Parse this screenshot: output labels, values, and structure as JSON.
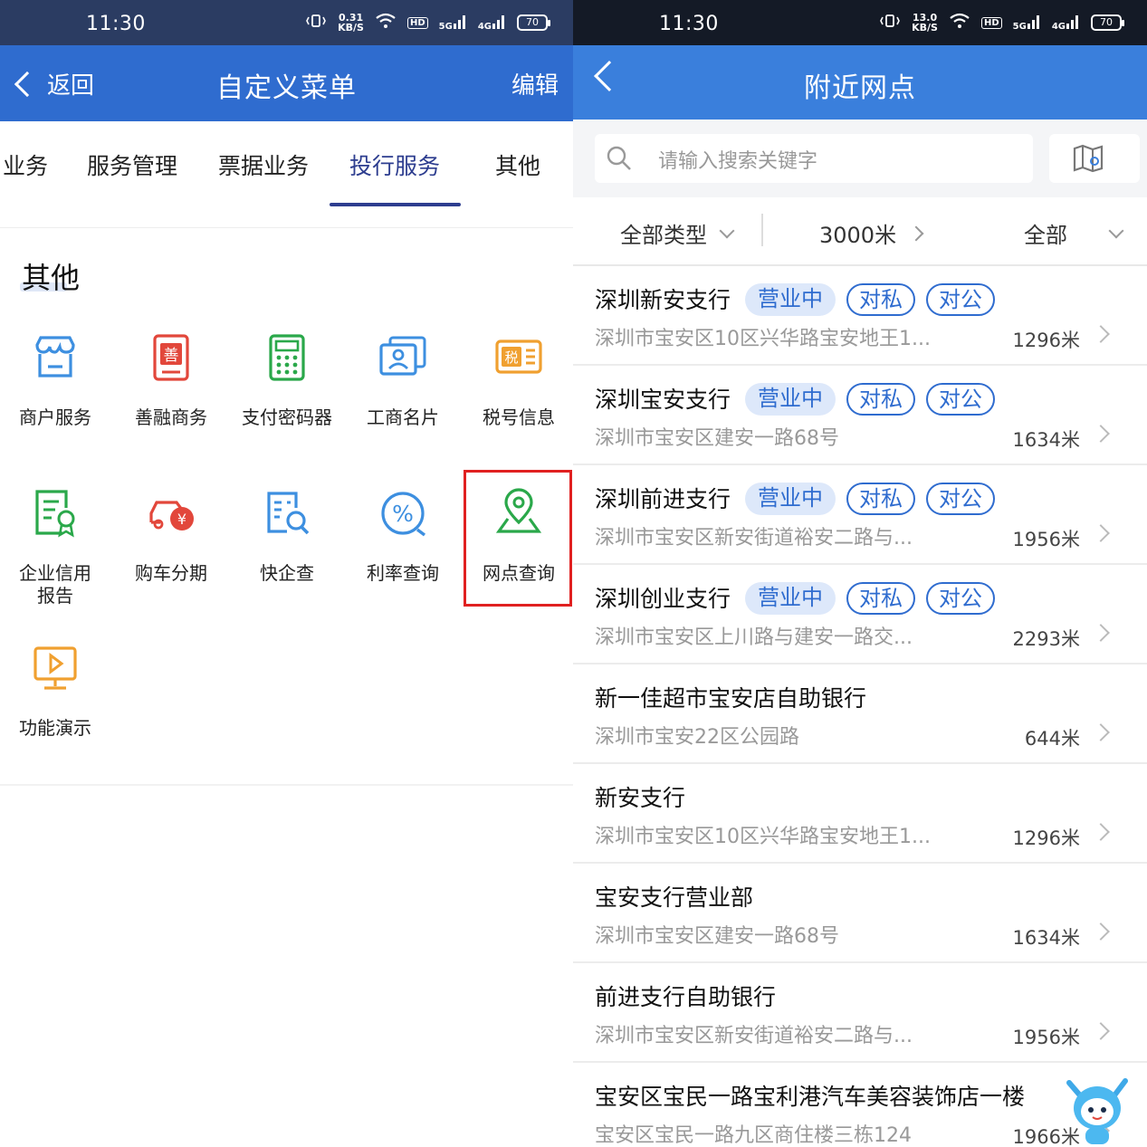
{
  "left": {
    "status": {
      "time": "11:30",
      "speed_value": "0.31",
      "speed_unit": "KB/S",
      "hd": "HD",
      "net5g": "5G",
      "net4g": "4G",
      "battery": "70"
    },
    "header": {
      "back_label": "返回",
      "title": "自定义菜单",
      "edit_label": "编辑"
    },
    "tabs": [
      "业务",
      "服务管理",
      "票据业务",
      "投行服务",
      "其他"
    ],
    "active_tab": "投行服务",
    "section_title": "其他",
    "items": [
      {
        "label": "商户服务",
        "icon": "shop-icon"
      },
      {
        "label": "善融商务",
        "icon": "shanrong-icon",
        "glyph": "善"
      },
      {
        "label": "支付密码器",
        "icon": "calculator-icon"
      },
      {
        "label": "工商名片",
        "icon": "business-card-icon"
      },
      {
        "label": "税号信息",
        "icon": "tax-icon",
        "glyph": "税"
      },
      {
        "label": "企业信用\n报告",
        "icon": "credit-report-icon"
      },
      {
        "label": "购车分期",
        "icon": "car-loan-icon",
        "glyph": "¥"
      },
      {
        "label": "快企查",
        "icon": "company-search-icon"
      },
      {
        "label": "利率查询",
        "icon": "interest-rate-icon",
        "glyph": "%"
      },
      {
        "label": "网点查询",
        "icon": "location-pin-icon"
      },
      {
        "label": "功能演示",
        "icon": "demo-play-icon"
      }
    ],
    "colors": {
      "header": "#2f6ccf",
      "blue_icon": "#3d8fe0",
      "red_icon": "#e2473b",
      "green_icon": "#2aa84a",
      "orange_icon": "#f0a030",
      "highlight": "#e02020"
    }
  },
  "right": {
    "status": {
      "time": "11:30",
      "speed_value": "13.0",
      "speed_unit": "KB/S",
      "hd": "HD",
      "net5g": "5G",
      "net4g": "4G",
      "battery": "70"
    },
    "header": {
      "title": "附近网点"
    },
    "search": {
      "placeholder": "请输入搜索关键字"
    },
    "filters": {
      "type": "全部类型",
      "distance": "3000米",
      "all": "全部"
    },
    "branches": [
      {
        "name": "深圳新安支行",
        "badges": [
          "营业中",
          "对私",
          "对公"
        ],
        "address": "深圳市宝安区10区兴华路宝安地王1...",
        "distance": "1296米"
      },
      {
        "name": "深圳宝安支行",
        "badges": [
          "营业中",
          "对私",
          "对公"
        ],
        "address": "深圳市宝安区建安一路68号",
        "distance": "1634米"
      },
      {
        "name": "深圳前进支行",
        "badges": [
          "营业中",
          "对私",
          "对公"
        ],
        "address": "深圳市宝安区新安街道裕安二路与...",
        "distance": "1956米"
      },
      {
        "name": "深圳创业支行",
        "badges": [
          "营业中",
          "对私",
          "对公"
        ],
        "address": "深圳市宝安区上川路与建安一路交...",
        "distance": "2293米"
      },
      {
        "name": "新一佳超市宝安店自助银行",
        "badges": [],
        "address": "深圳市宝安22区公园路",
        "distance": "644米"
      },
      {
        "name": "新安支行",
        "badges": [],
        "address": "深圳市宝安区10区兴华路宝安地王1...",
        "distance": "1296米"
      },
      {
        "name": "宝安支行营业部",
        "badges": [],
        "address": "深圳市宝安区建安一路68号",
        "distance": "1634米"
      },
      {
        "name": "前进支行自助银行",
        "badges": [],
        "address": "深圳市宝安区新安街道裕安二路与...",
        "distance": "1956米"
      },
      {
        "name": "宝安区宝民一路宝利港汽车美容装饰店一楼",
        "badges": [],
        "address": "宝安区宝民一路九区商住楼三栋124",
        "distance": "1966米"
      }
    ],
    "colors": {
      "header": "#3a7fdc",
      "badge": "#2f6ccf",
      "badge_bg": "#dde8fa"
    }
  }
}
